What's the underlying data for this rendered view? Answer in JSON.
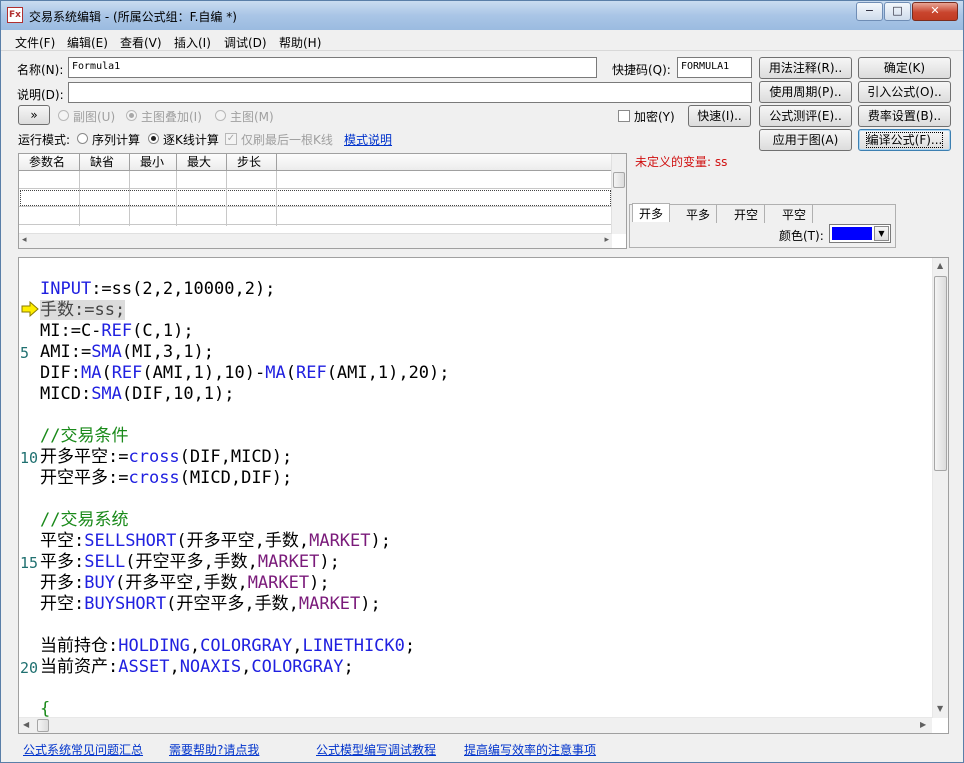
{
  "window": {
    "title": "交易系统编辑 - (所属公式组：F.自编 *)",
    "app_icon": "Fx",
    "controls": {
      "minimize": "−",
      "maximize": "□",
      "close": "✕"
    }
  },
  "menu": [
    "文件(F)",
    "编辑(E)",
    "查看(V)",
    "插入(I)",
    "调试(D)",
    "帮助(H)"
  ],
  "form": {
    "name_label": "名称(N):",
    "name_value": "Formula1",
    "shortcut_label": "快捷码(Q):",
    "shortcut_value": "FORMULA1",
    "desc_label": "说明(D):",
    "desc_value": "",
    "expand_button": "»",
    "chart_options": [
      "副图(U)",
      "主图叠加(I)",
      "主图(M)"
    ],
    "encrypt_label": "加密(Y)",
    "quick_button": "快速(I)..",
    "run_mode_label": "运行模式:",
    "run_mode_options": [
      "序列计算",
      "逐K线计算"
    ],
    "last_bar_only": "仅刷最后一根K线",
    "mode_help_link": "模式说明"
  },
  "right_buttons": {
    "usage_note": "用法注释(R)..",
    "confirm": "确定(K)",
    "period": "使用周期(P)..",
    "import": "引入公式(O)..",
    "test": "公式测评(E)..",
    "fee": "费率设置(B)..",
    "apply_chart": "应用于图(A)",
    "compile": "编译公式(F)..."
  },
  "params_table": {
    "columns": [
      "参数名",
      "缺省",
      "最小",
      "最大",
      "步长"
    ],
    "rows": [
      [
        "",
        "",
        "",
        "",
        ""
      ],
      [
        "",
        "",
        "",
        "",
        ""
      ],
      [
        "",
        "",
        "",
        "",
        ""
      ]
    ]
  },
  "undefined_vars": "未定义的变量:  ss",
  "signal_tabs": [
    "开多",
    "平多",
    "开空",
    "平空"
  ],
  "color_label": "颜色(T):",
  "color_value": "#0000ff",
  "editor": {
    "line_numbers": [
      "5",
      "10",
      "15",
      "20"
    ],
    "pointer_icon": "execution-pointer-arrow",
    "lines": [
      [
        [
          "p",
          "INPUT"
        ],
        [
          "t",
          ":=ss(2,2,10000,2);"
        ]
      ],
      [
        [
          "h",
          "手数:=ss;"
        ]
      ],
      [
        [
          "t",
          "MI:=C-"
        ],
        [
          "k",
          "REF"
        ],
        [
          "t",
          "(C,1);"
        ]
      ],
      [
        [
          "t",
          "AMI:="
        ],
        [
          "k",
          "SMA"
        ],
        [
          "t",
          "(MI,3,1);"
        ]
      ],
      [
        [
          "t",
          "DIF:"
        ],
        [
          "k",
          "MA"
        ],
        [
          "t",
          "("
        ],
        [
          "k",
          "REF"
        ],
        [
          "t",
          "(AMI,1),10)-"
        ],
        [
          "k",
          "MA"
        ],
        [
          "t",
          "("
        ],
        [
          "k",
          "REF"
        ],
        [
          "t",
          "(AMI,1),20);"
        ]
      ],
      [
        [
          "t",
          "MICD:"
        ],
        [
          "k",
          "SMA"
        ],
        [
          "t",
          "(DIF,10,1);"
        ]
      ],
      [],
      [
        [
          "c",
          "//交易条件"
        ]
      ],
      [
        [
          "t",
          "开多平空:="
        ],
        [
          "k",
          "cross"
        ],
        [
          "t",
          "(DIF,MICD);"
        ]
      ],
      [
        [
          "t",
          "开空平多:="
        ],
        [
          "k",
          "cross"
        ],
        [
          "t",
          "(MICD,DIF);"
        ]
      ],
      [],
      [
        [
          "c",
          "//交易系统"
        ]
      ],
      [
        [
          "t",
          "平空:"
        ],
        [
          "k",
          "SELLSHORT"
        ],
        [
          "t",
          "(开多平空,手数,"
        ],
        [
          "m",
          "MARKET"
        ],
        [
          "t",
          ");"
        ]
      ],
      [
        [
          "t",
          "平多:"
        ],
        [
          "k",
          "SELL"
        ],
        [
          "t",
          "(开空平多,手数,"
        ],
        [
          "m",
          "MARKET"
        ],
        [
          "t",
          ");"
        ]
      ],
      [
        [
          "t",
          "开多:"
        ],
        [
          "k",
          "BUY"
        ],
        [
          "t",
          "(开多平空,手数,"
        ],
        [
          "m",
          "MARKET"
        ],
        [
          "t",
          ");"
        ]
      ],
      [
        [
          "t",
          "开空:"
        ],
        [
          "k",
          "BUYSHORT"
        ],
        [
          "t",
          "(开空平多,手数,"
        ],
        [
          "m",
          "MARKET"
        ],
        [
          "t",
          ");"
        ]
      ],
      [],
      [
        [
          "t",
          "当前持仓:"
        ],
        [
          "k",
          "HOLDING"
        ],
        [
          "t",
          ","
        ],
        [
          "k",
          "COLORGRAY"
        ],
        [
          "t",
          ","
        ],
        [
          "k",
          "LINETHICK0"
        ],
        [
          "t",
          ";"
        ]
      ],
      [
        [
          "t",
          "当前资产:"
        ],
        [
          "k",
          "ASSET"
        ],
        [
          "t",
          ","
        ],
        [
          "k",
          "NOAXIS"
        ],
        [
          "t",
          ","
        ],
        [
          "k",
          "COLORGRAY"
        ],
        [
          "t",
          ";"
        ]
      ],
      [],
      [
        [
          "c",
          "{"
        ]
      ]
    ]
  },
  "footer_links": [
    "公式系统常见问题汇总",
    "需要帮助?请点我",
    "公式模型编写调试教程",
    "提高编写效率的注意事项"
  ]
}
